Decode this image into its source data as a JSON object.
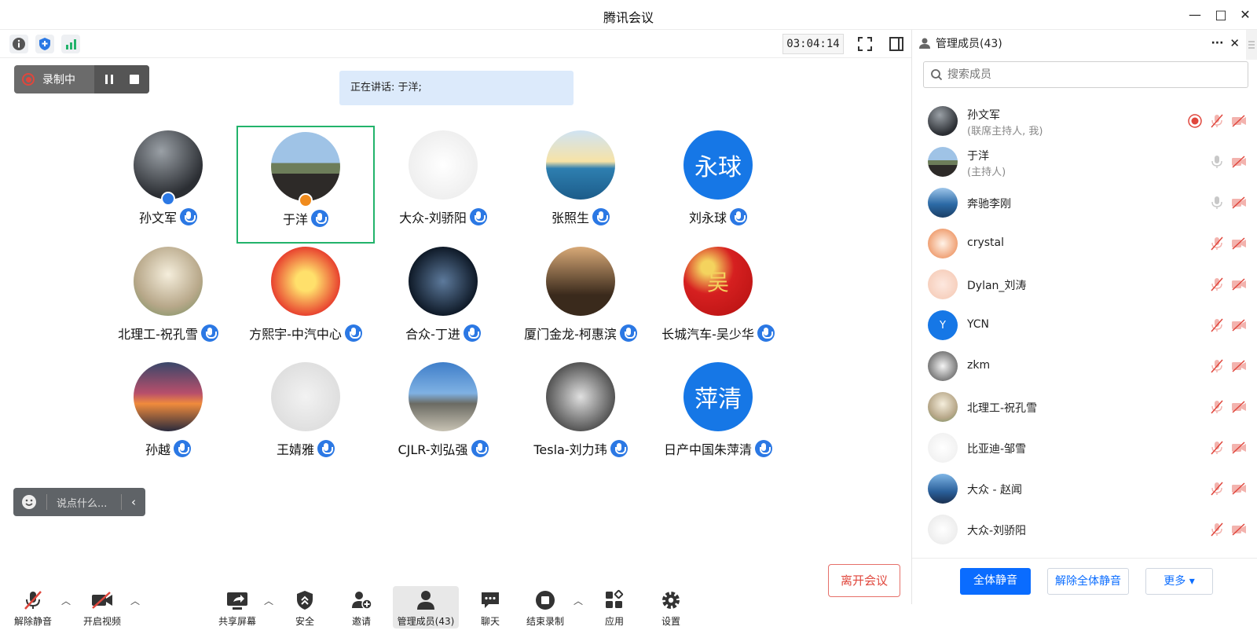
{
  "window": {
    "title": "腾讯会议",
    "minimize": "—",
    "maximize": "□",
    "close": "✕"
  },
  "infobar": {
    "timer": "03:04:14"
  },
  "recording": {
    "label": "录制中"
  },
  "speaking": {
    "text": "正在讲话: 于洋;"
  },
  "participants_grid": [
    {
      "name": "孙文军",
      "host_badge": true
    },
    {
      "name": "于洋",
      "active": true,
      "host_badge": true
    },
    {
      "name": "大众-刘骄阳"
    },
    {
      "name": "张照生"
    },
    {
      "name": "刘永球",
      "avatar_text": "永球"
    },
    {
      "name": "北理工-祝孔雪"
    },
    {
      "name": "方熙宇-中汽中心"
    },
    {
      "name": "合众-丁进"
    },
    {
      "name": "厦门金龙-柯惠滨"
    },
    {
      "name": "长城汽车-吴少华",
      "avatar_text": "吴"
    },
    {
      "name": "孙越"
    },
    {
      "name": "王婧雅"
    },
    {
      "name": "CJLR-刘弘强"
    },
    {
      "name": "Tesla-刘力玮"
    },
    {
      "name": "日产中国朱萍清",
      "avatar_text": "萍清"
    }
  ],
  "chat": {
    "placeholder": "说点什么..."
  },
  "toolbar": {
    "unmute": "解除静音",
    "start_video": "开启视频",
    "share_screen": "共享屏幕",
    "security": "安全",
    "invite": "邀请",
    "manage_members": "管理成员(43)",
    "chat": "聊天",
    "end_recording": "结束录制",
    "apps": "应用",
    "settings": "设置",
    "leave": "离开会议"
  },
  "panel": {
    "title": "管理成员(43)",
    "more": "···",
    "close": "✕",
    "search_placeholder": "搜索成员",
    "members": [
      {
        "name": "孙文军",
        "sub": "(联席主持人, 我)",
        "recording": true
      },
      {
        "name": "于洋",
        "sub": "(主持人)"
      },
      {
        "name": "奔驰李刚"
      },
      {
        "name": "crystal"
      },
      {
        "name": "Dylan_刘涛"
      },
      {
        "name": "YCN",
        "initial": "Y"
      },
      {
        "name": "zkm"
      },
      {
        "name": "北理工-祝孔雪"
      },
      {
        "name": "比亚迪-邹雪"
      },
      {
        "name": "大众 - 赵闻"
      },
      {
        "name": "大众-刘骄阳"
      }
    ],
    "mute_all": "全体静音",
    "unmute_all": "解除全体静音",
    "more_btn": "更多 ▾"
  },
  "colors": {
    "accent": "#0a6cff",
    "active_border": "#22b36b",
    "leave": "#e0463c"
  }
}
